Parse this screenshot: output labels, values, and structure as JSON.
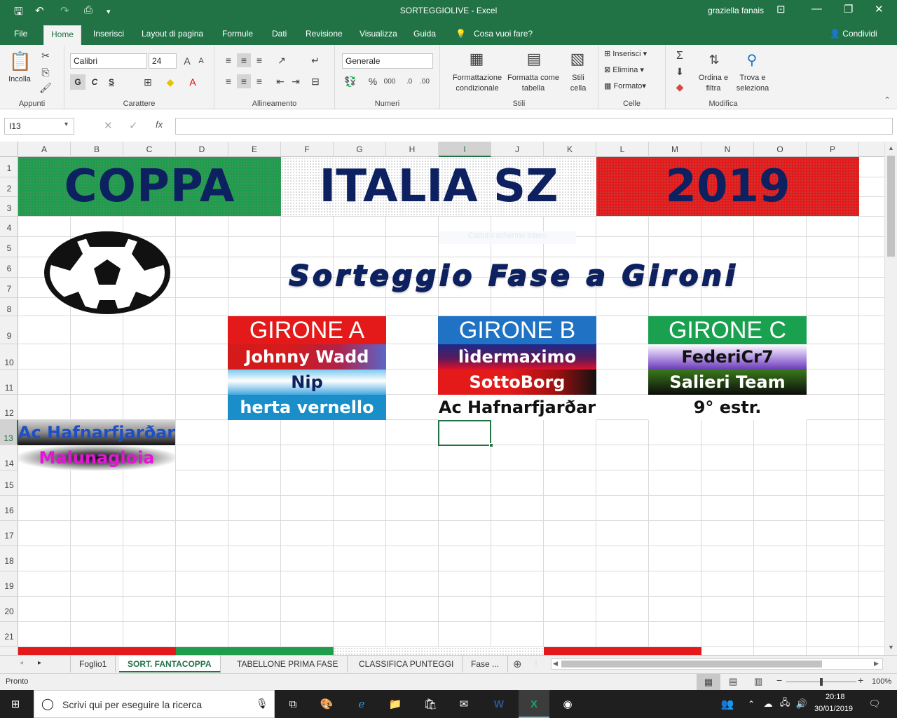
{
  "window": {
    "title": "SORTEGGIOLIVE  -  Excel",
    "user": "graziella fanais"
  },
  "ribbon_tabs": [
    "File",
    "Home",
    "Inserisci",
    "Layout di pagina",
    "Formule",
    "Dati",
    "Revisione",
    "Visualizza",
    "Guida"
  ],
  "tell_me": "Cosa vuoi fare?",
  "share": "Condividi",
  "clipboard": {
    "paste": "Incolla",
    "label": "Appunti"
  },
  "font": {
    "name": "Calibri",
    "size": "24",
    "bold": "G",
    "italic": "C",
    "underline": "S",
    "label": "Carattere"
  },
  "alignment": {
    "label": "Allineamento"
  },
  "number": {
    "format": "Generale",
    "label": "Numeri"
  },
  "styles": {
    "conditional": "Formattazione condizionale",
    "as_table": "Formatta come tabella",
    "cell_styles": "Stili cella",
    "label": "Stili"
  },
  "cells": {
    "insert": "Inserisci",
    "delete": "Elimina",
    "format": "Formato",
    "label": "Celle"
  },
  "editing": {
    "sort": "Ordina e filtra",
    "find": "Trova e seleziona",
    "label": "Modifica"
  },
  "formula_bar": {
    "name_box": "I13",
    "formula": ""
  },
  "columns": [
    "A",
    "B",
    "C",
    "D",
    "E",
    "F",
    "G",
    "H",
    "I",
    "J",
    "K",
    "L",
    "M",
    "N",
    "O",
    "P"
  ],
  "rows": [
    "1",
    "2",
    "3",
    "4",
    "5",
    "6",
    "7",
    "8",
    "9",
    "10",
    "11",
    "12",
    "13",
    "14",
    "15",
    "16",
    "17",
    "18",
    "19",
    "20",
    "21"
  ],
  "selected_col": "I",
  "selected_row": "13",
  "banner": {
    "left": "COPPA",
    "mid": "ITALIA SZ",
    "right": "2019"
  },
  "subtitle": "Sorteggio Fase a Gironi",
  "ghost_text": "Cattura schermo intero",
  "groups": [
    {
      "title": "GIRONE A",
      "teams": [
        "Johnny Wadd",
        "Nip",
        "herta vernello"
      ]
    },
    {
      "title": "GIRONE B",
      "teams": [
        "lìdermaximo",
        "SottoBorg",
        "Ac Hafnarfjarðar"
      ]
    },
    {
      "title": "GIRONE C",
      "teams": [
        "FederiCr7",
        "Salieri Team",
        "9° estr."
      ]
    }
  ],
  "pool": [
    "Ac Hafnarfjarðar",
    "Maiunagioia"
  ],
  "sheets": [
    "Foglio1",
    "SORT. FANTACOPPA",
    "TABELLONE PRIMA FASE",
    "CLASSIFICA PUNTEGGI",
    "Fase ..."
  ],
  "status": {
    "ready": "Pronto",
    "zoom": "100%"
  },
  "taskbar": {
    "search": "Scrivi qui per eseguire la ricerca",
    "time": "20:18",
    "date": "30/01/2019"
  },
  "colors": {
    "excel_green": "#217346",
    "title_navy": "#0d2060",
    "green": "#1f9c4c",
    "red": "#e41a1a",
    "blue": "#1f72c4"
  }
}
